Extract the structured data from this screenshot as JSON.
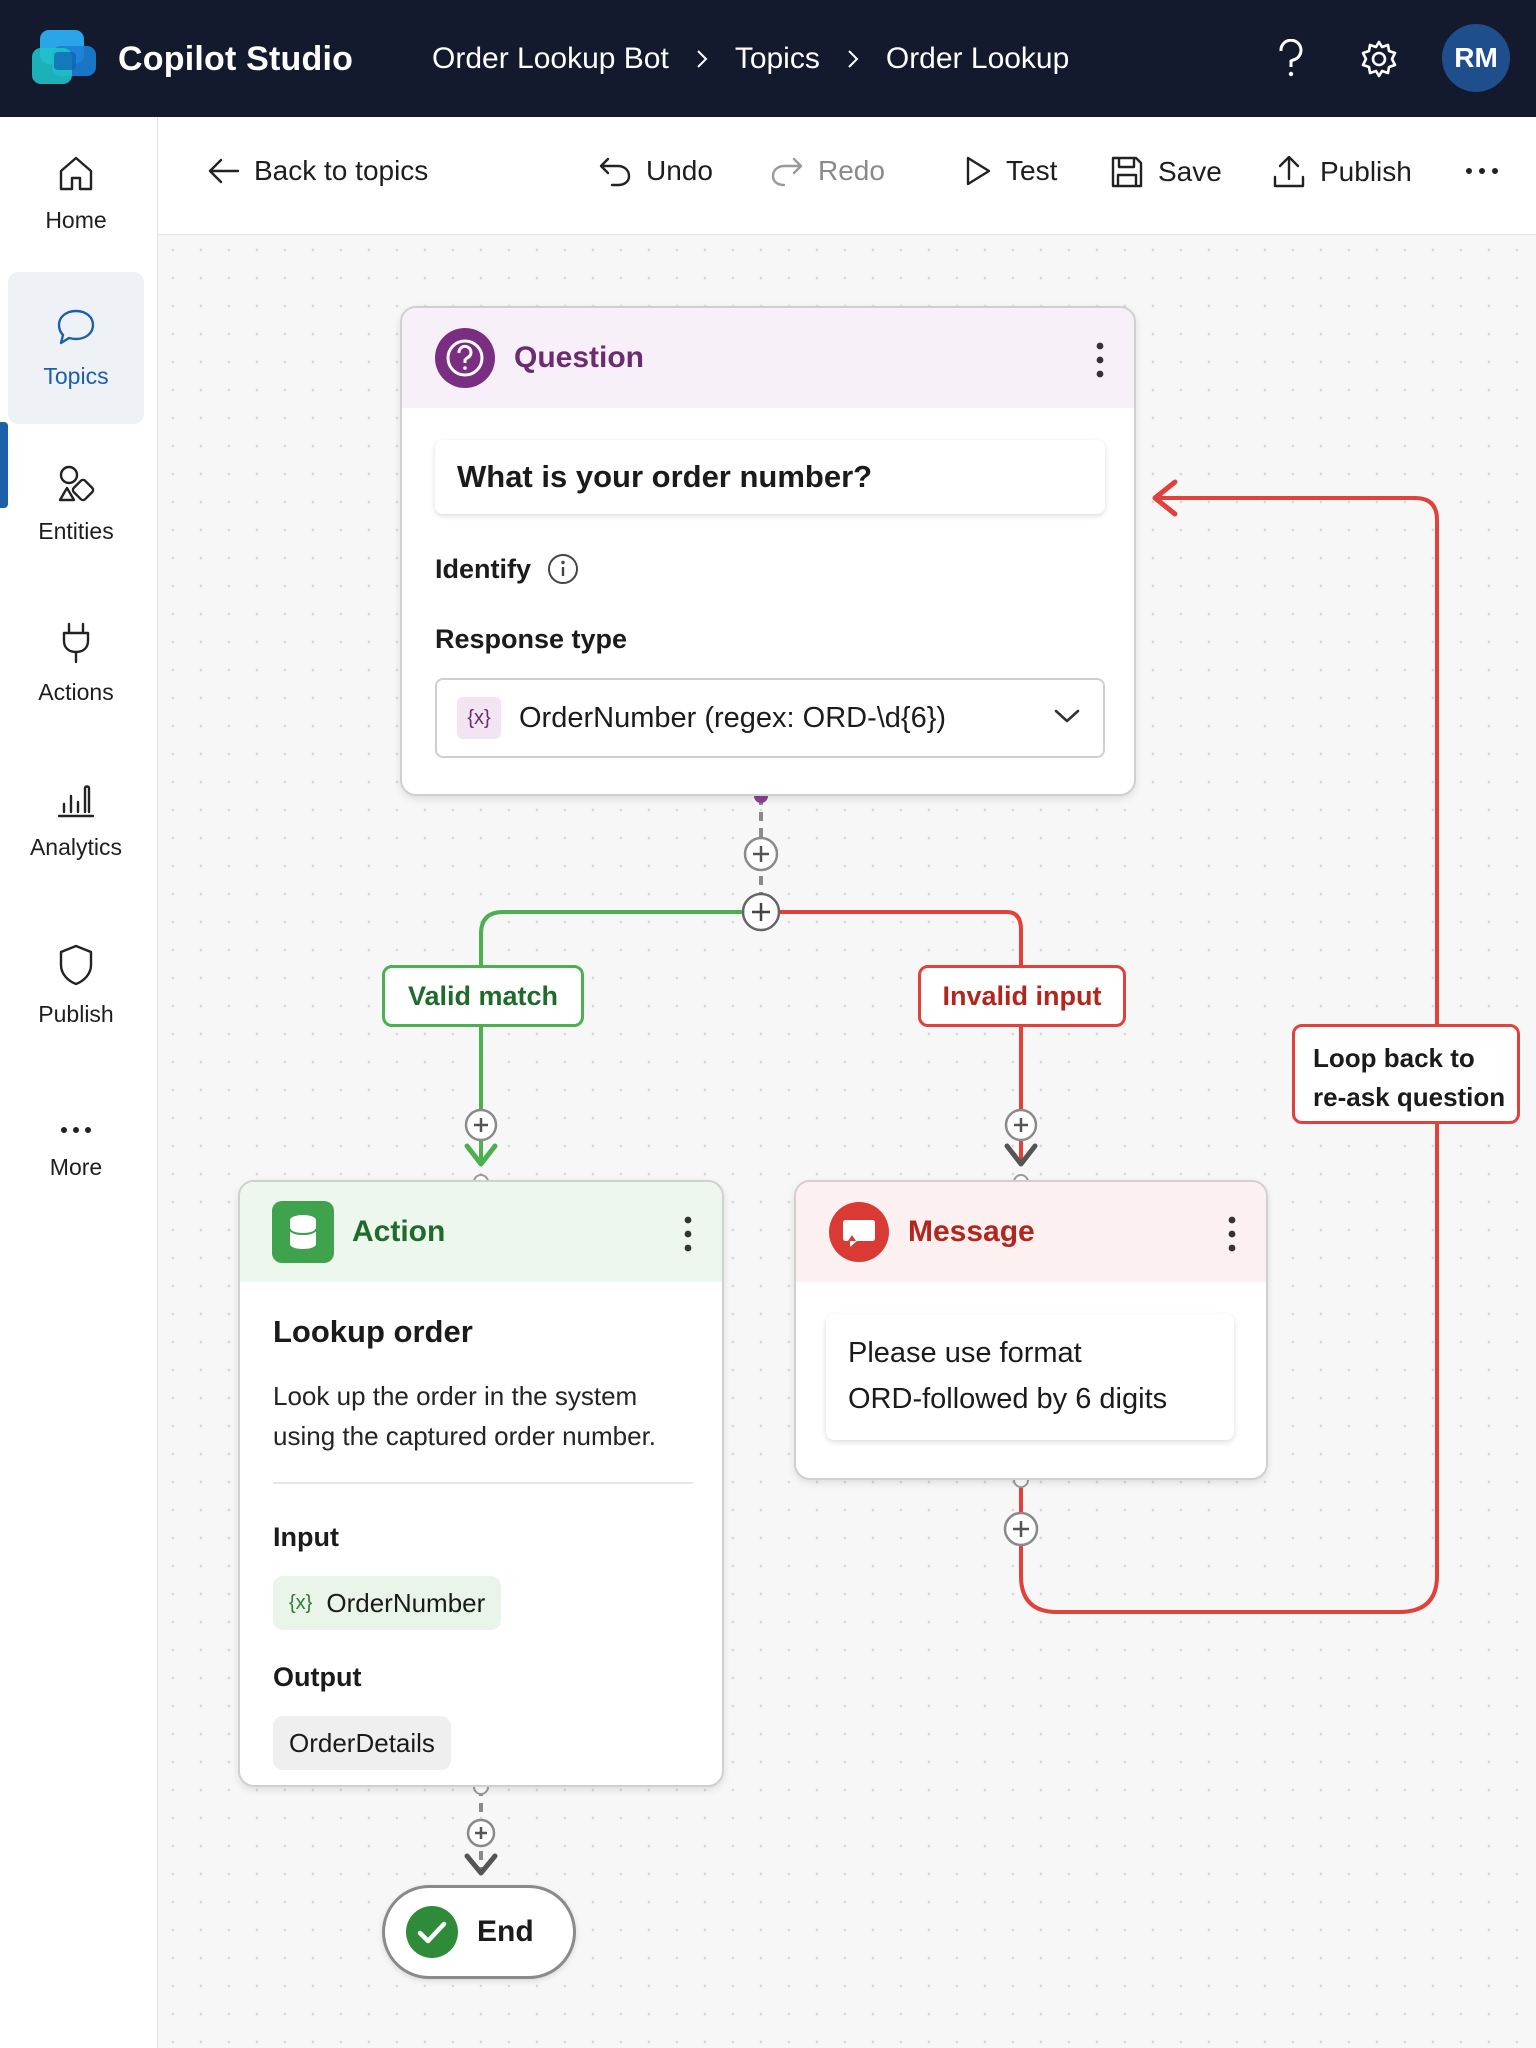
{
  "app": {
    "title": "Copilot Studio",
    "avatar_initials": "RM"
  },
  "breadcrumb": [
    "Order Lookup Bot",
    "Topics",
    "Order Lookup"
  ],
  "rail": [
    {
      "label": "Home",
      "icon": "home-icon"
    },
    {
      "label": "Topics",
      "icon": "chat-icon",
      "active": true
    },
    {
      "label": "Entities",
      "icon": "entities-icon"
    },
    {
      "label": "Actions",
      "icon": "plug-icon"
    },
    {
      "label": "Analytics",
      "icon": "analytics-icon"
    },
    {
      "label": "Publish",
      "icon": "shield-icon"
    },
    {
      "label": "More",
      "icon": "more-icon"
    }
  ],
  "toolbar": {
    "back": "Back to topics",
    "undo": "Undo",
    "redo": "Redo",
    "test": "Test",
    "save": "Save",
    "publish": "Publish"
  },
  "question_node": {
    "type_label": "Question",
    "prompt": "What is your order number?",
    "identify_label": "Identify",
    "response_type_label": "Response type",
    "response_chip": "{x}",
    "response_value": "OrderNumber (regex: ORD-\\d{6})"
  },
  "branches": {
    "valid": "Valid match",
    "invalid": "Invalid input"
  },
  "loop_label": [
    "Loop back to",
    "re-ask question"
  ],
  "action_node": {
    "type_label": "Action",
    "heading": "Lookup order",
    "description": "Look up the order in the system using the captured order number.",
    "input_label": "Input",
    "input_chip": "{x}",
    "input_value": "OrderNumber",
    "output_label": "Output",
    "output_value": "OrderDetails"
  },
  "message_node": {
    "type_label": "Message",
    "text_line1": "Please use format",
    "text_line2": "ORD-followed by 6 digits"
  },
  "end_node": {
    "label": "End"
  },
  "colors": {
    "topbar": "#131a2e",
    "accent": "#1d5fa8",
    "question": "#6b2c72",
    "valid_green": "#4caf50",
    "invalid_red": "#e0413a"
  }
}
